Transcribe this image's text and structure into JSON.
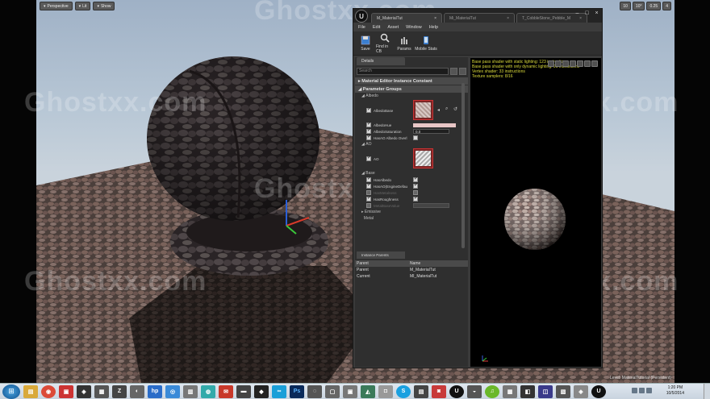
{
  "viewport": {
    "buttons": [
      "Perspective",
      "Lit",
      "Show"
    ],
    "right_values": [
      "10",
      "10°",
      "0.25",
      "4"
    ],
    "bottom_label": "Level: MaterialTutorial (Persistent)"
  },
  "watermark": "Ghostxx.com",
  "editor": {
    "tabs": [
      "M_MaterialTut",
      "Mi_MaterialTut",
      "T_CobbleStone_Pebble_M"
    ],
    "menu": [
      "File",
      "Edit",
      "Asset",
      "Window",
      "Help"
    ],
    "toolbar": [
      "Save",
      "Find in CB",
      "Params",
      "Mobile Stats"
    ],
    "details": {
      "tab": "Details",
      "search_placeholder": "Search",
      "section_instance": "Material Editor Instance Constant",
      "section_params": "Parameter Groups",
      "group_albedo": "Albedo",
      "albedo_props": [
        {
          "label": "AlbedoBase",
          "checked": true
        },
        {
          "label": "AlbedoHue",
          "checked": true
        },
        {
          "label": "AlbedoSaturation",
          "checked": true,
          "value": "0.0"
        },
        {
          "label": "HasAO Albedo Overl",
          "checked": true
        }
      ],
      "group_ao": "AO",
      "ao_prop": "AO",
      "group_base": "Base",
      "base_props": [
        {
          "label": "HasAlbedo",
          "checked": true,
          "disabled": false
        },
        {
          "label": "HasAO(EngineDefau",
          "checked": true,
          "disabled": false
        },
        {
          "label": "HasMetalness",
          "checked": false,
          "disabled": true
        },
        {
          "label": "HasRoughness",
          "checked": true,
          "disabled": false
        },
        {
          "label": "MetalBaseValue",
          "checked": false,
          "disabled": true
        }
      ],
      "group_emissive": "Emissive",
      "group_metal": "Metal"
    },
    "parents": {
      "tab": "Instance Parents",
      "headers": [
        "Parent",
        "Name"
      ],
      "rows": [
        [
          "Parent",
          "M_MaterialTut"
        ],
        [
          "Current",
          "MI_MaterialTut"
        ]
      ]
    },
    "preview_stats": [
      "Base pass shader with static lighting: 123 instructions",
      "Base pass shader with only dynamic lighting: 91 instructions",
      "Vertex shader: 33 instructions",
      "Texture samplers: 8/16"
    ]
  },
  "taskbar": {
    "time": "1:20 PM",
    "date": "10/5/2014"
  },
  "colors": {
    "accent_yellow": "#d9d93a",
    "selection_red": "#c33333"
  }
}
